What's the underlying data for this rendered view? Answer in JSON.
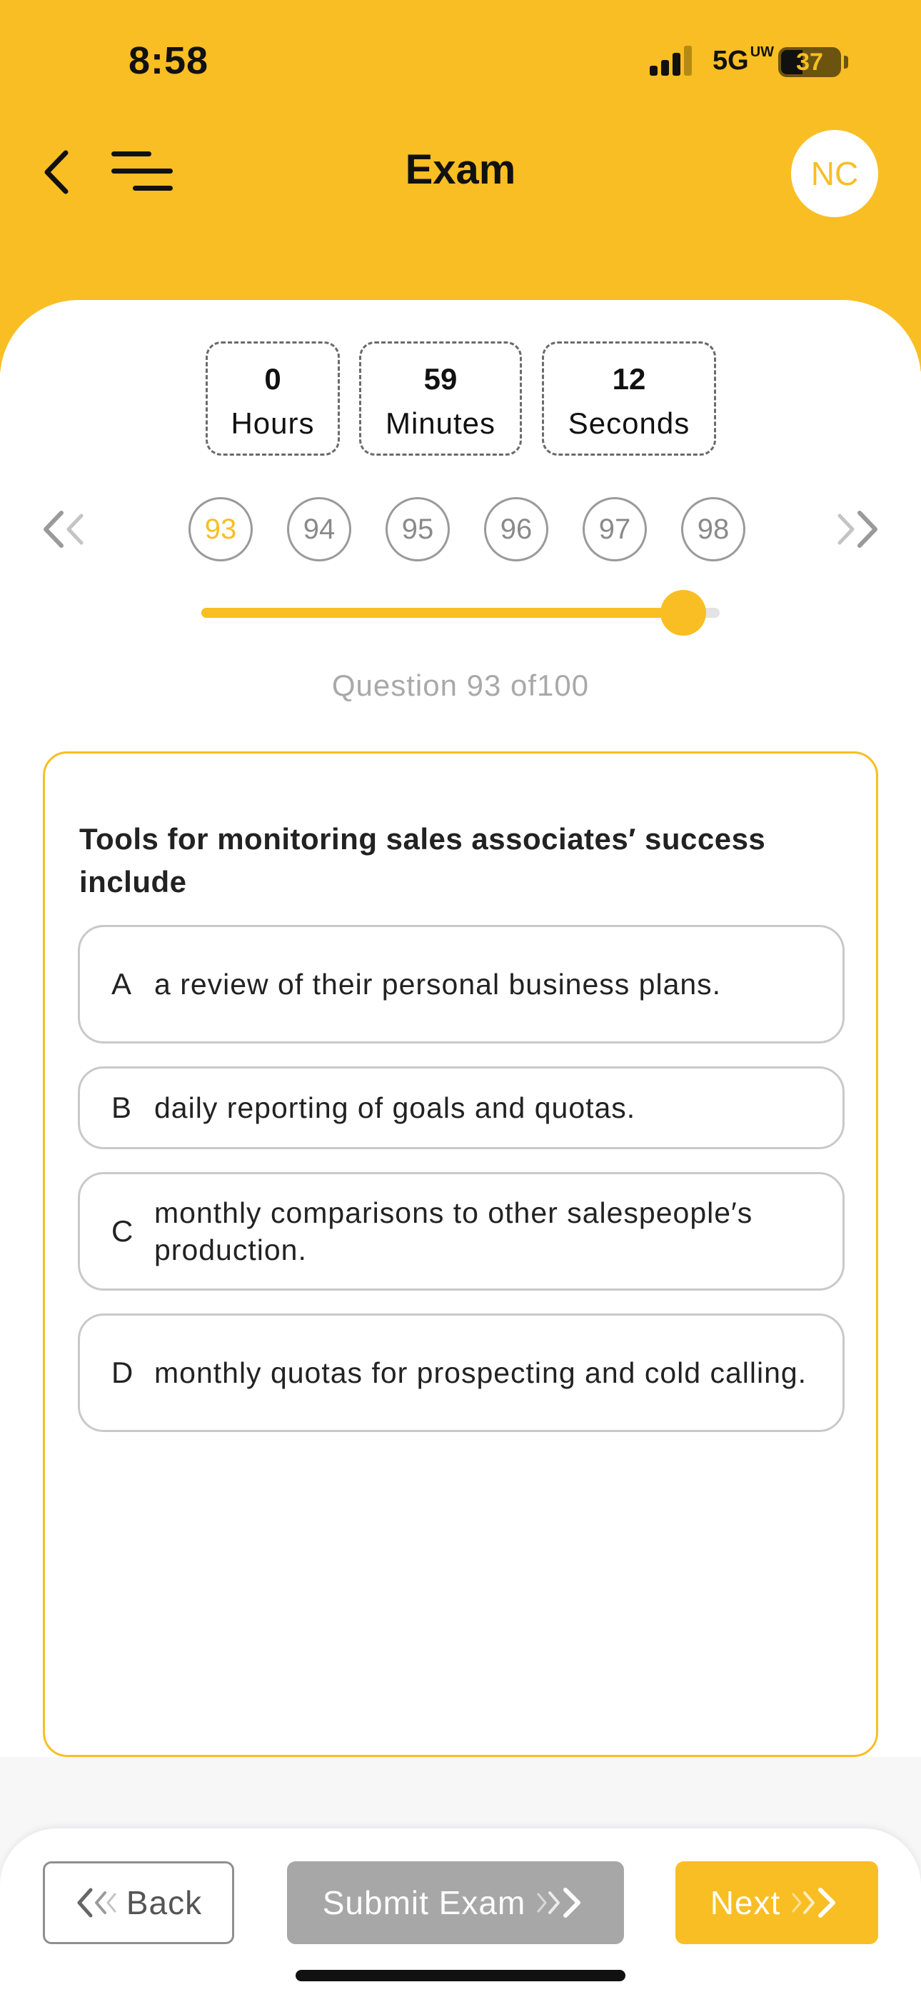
{
  "status_bar": {
    "time": "8:58",
    "network": "5G",
    "network_suffix": "UW",
    "battery": "37"
  },
  "header": {
    "title": "Exam",
    "avatar_initials": "NC",
    "back_icon": "chevron-left-icon",
    "menu_icon": "menu-icon"
  },
  "timer": {
    "hours_value": "0",
    "hours_label": "Hours",
    "minutes_value": "59",
    "minutes_label": "Minutes",
    "seconds_value": "12",
    "seconds_label": "Seconds"
  },
  "question_nav": {
    "prev_icon": "double-chevron-left-icon",
    "next_icon": "double-chevron-right-icon",
    "numbers": [
      "93",
      "94",
      "95",
      "96",
      "97",
      "98"
    ],
    "active": "93"
  },
  "progress": {
    "current": 93,
    "total": 100,
    "label": "Question 93 of100"
  },
  "question": {
    "text": "Tools for monitoring sales associates′ success include",
    "options": [
      {
        "letter": "A",
        "text": "a review of their personal business plans."
      },
      {
        "letter": "B",
        "text": "daily reporting of goals and quotas."
      },
      {
        "letter": "C",
        "text": "monthly comparisons to other salespeople′s production."
      },
      {
        "letter": "D",
        "text": "monthly quotas for prospecting and cold calling."
      }
    ]
  },
  "footer": {
    "back_label": "Back",
    "submit_label": "Submit Exam",
    "next_label": "Next"
  },
  "colors": {
    "accent": "#f8be23",
    "submit_disabled": "#a7a7a7"
  }
}
